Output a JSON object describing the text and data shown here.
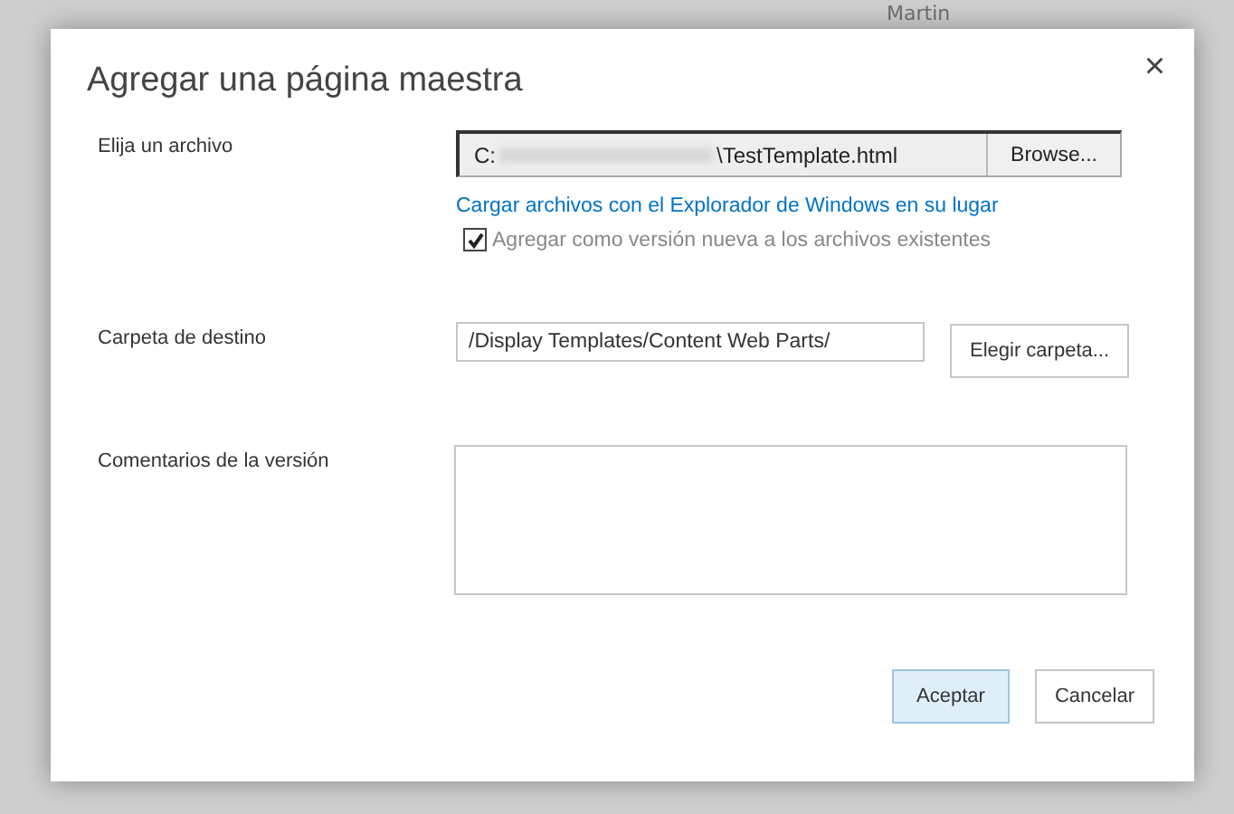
{
  "background": {
    "names": [
      "Martin"
    ]
  },
  "dialog": {
    "title": "Agregar una página maestra",
    "close": "×",
    "file": {
      "label": "Elija un archivo",
      "path_start": "C:",
      "path_end": "\\TestTemplate.html",
      "browse": "Browse...",
      "explorer_link": "Cargar archivos con el Explorador de Windows en su lugar",
      "overwrite": {
        "label": "Agregar como versión nueva a los archivos existentes",
        "checked": true
      }
    },
    "destination": {
      "label": "Carpeta de destino",
      "value": "/Display Templates/Content Web Parts/",
      "button": "Elegir carpeta..."
    },
    "comments": {
      "label": "Comentarios de la versión"
    },
    "buttons": [
      {
        "label": "Aceptar",
        "primary": true
      },
      {
        "label": "Cancelar",
        "primary": false
      }
    ]
  }
}
